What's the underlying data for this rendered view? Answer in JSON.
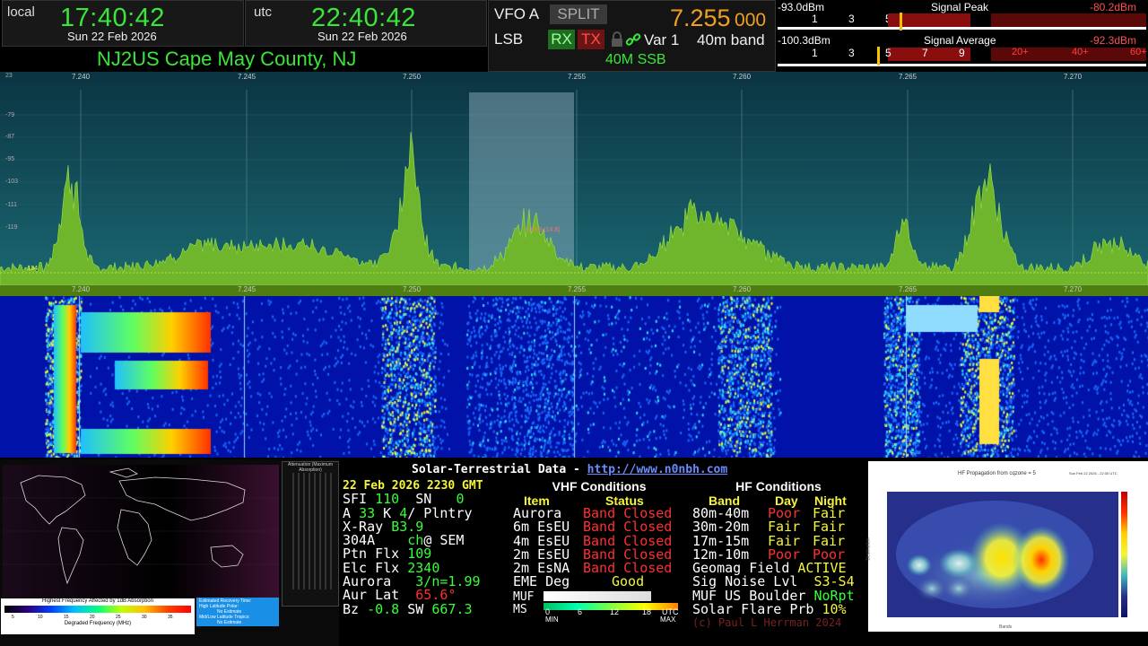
{
  "clocks": {
    "local": {
      "label": "local",
      "time": "17:40:42",
      "date": "Sun 22 Feb 2026"
    },
    "utc": {
      "label": "utc",
      "time": "22:40:42",
      "date": "Sun 22 Feb 2026"
    }
  },
  "station": "NJ2US Cape May County, NJ",
  "vfo": {
    "name": "VFO A",
    "split_label": "SPLIT",
    "mode": "LSB",
    "rx_label": "RX",
    "tx_label": "TX",
    "var_label": "Var 1",
    "frequency_main": "7.255",
    "frequency_sub": "000",
    "band": "40m band",
    "band_mode": "40M SSB"
  },
  "meters": {
    "peak": {
      "dbm": "-93.0dBm",
      "title": "Signal Peak",
      "right_dbm": "-80.2dBm",
      "level_fraction": 0.61
    },
    "average": {
      "dbm": "-100.3dBm",
      "title": "Signal Average",
      "right_dbm": "-92.3dBm",
      "level_fraction": 0.51
    },
    "ticks": [
      "1",
      "3",
      "5",
      "7",
      "9"
    ],
    "plus_ticks": [
      "20+",
      "40+",
      "60+"
    ]
  },
  "spectrum": {
    "freq_labels": [
      "7.240",
      "7.245",
      "7.250",
      "7.255",
      "7.260",
      "7.265",
      "7.270"
    ],
    "db_labels": [
      "23",
      "-79",
      "-87",
      "-95",
      "-103",
      "-111",
      "-119"
    ],
    "marker_text": "-119.9 (14.8)",
    "low_label": "-134"
  },
  "map": {
    "chart_title": "Attenuation (Maximum Absorption)",
    "legend_title": "Highest Frequency Affected by 1dB Absorption",
    "legend_axis": "Degraded Frequency (MHz)",
    "legend_ticks": [
      "5",
      "10",
      "15",
      "20",
      "25",
      "30",
      "35"
    ],
    "info_box": [
      "Estimated Recovery Time:",
      "High Latitude Polar:",
      "No Estimate",
      "Mid/Low Latitude Tropics:",
      "No Estimate"
    ]
  },
  "solar": {
    "title": "Solar-Terrestrial Data - ",
    "link": "http://www.n0nbh.com",
    "date": "22 Feb 2026 2230 GMT",
    "left_rows": [
      {
        "label": "SFI",
        "value": "110",
        "label2": "SN",
        "value2": "0"
      },
      {
        "label": "A",
        "value": "33",
        "label2": "K",
        "value2": "4",
        "extra": "/ Plntry"
      },
      {
        "label": "X-Ray",
        "value": "B3.9"
      },
      {
        "label": "304A",
        "value": "ch",
        "extra": "@ SEM"
      },
      {
        "label": "Ptn Flx",
        "value": "109"
      },
      {
        "label": "Elc Flx",
        "value": "2340"
      },
      {
        "label": "Aurora",
        "value": "3/n=",
        "value2": "1.99"
      },
      {
        "label": "Aur Lat",
        "value": "65.6°"
      },
      {
        "label": "Bz",
        "value": "-0.8",
        "label2": "SW",
        "value2": "667.3"
      }
    ],
    "vhf": {
      "title": "VHF Conditions",
      "col_item": "Item",
      "col_status": "Status",
      "rows": [
        {
          "item": "Aurora",
          "status": "Band Closed"
        },
        {
          "item": "6m EsEU",
          "status": "Band Closed"
        },
        {
          "item": "4m EsEU",
          "status": "Band Closed"
        },
        {
          "item": "2m EsEU",
          "status": "Band Closed"
        },
        {
          "item": "2m EsNA",
          "status": "Band Closed"
        },
        {
          "item": "EME Deg",
          "status": "Good"
        }
      ],
      "muf_label": "MUF",
      "ms_label": "MS",
      "scale": [
        "0",
        "6",
        "12",
        "18"
      ],
      "scale_utc": "UTC",
      "scale_min": "MIN",
      "scale_max": "MAX"
    },
    "hf": {
      "title": "HF Conditions",
      "col_band": "Band",
      "col_day": "Day",
      "col_night": "Night",
      "rows": [
        {
          "band": "80m-40m",
          "day": "Poor",
          "night": "Fair"
        },
        {
          "band": "30m-20m",
          "day": "Fair",
          "night": "Fair"
        },
        {
          "band": "17m-15m",
          "day": "Fair",
          "night": "Fair"
        },
        {
          "band": "12m-10m",
          "day": "Poor",
          "night": "Poor"
        }
      ],
      "geomag_label": "Geomag Field",
      "geomag_value": "ACTIVE",
      "signoise_label": "Sig Noise Lvl",
      "signoise_value": "S3-S4",
      "muf_label": "MUF US Boulder",
      "muf_value": "NoRpt",
      "flare_label": "Solar Flare Prb",
      "flare_value": "10%",
      "footer": "(c) Paul L Herrman 2024"
    }
  },
  "propagation": {
    "title": "HF Propagation from cqzone = 5",
    "timestamp": "Sun Feb 22 2026 - 22:30 UTC",
    "xlabel": "Bands",
    "ylabel": "Destination"
  },
  "colors": {
    "green": "#39e639",
    "red": "#ff3030",
    "yellow": "#f5f53a",
    "cyan": "#33e0e0"
  }
}
